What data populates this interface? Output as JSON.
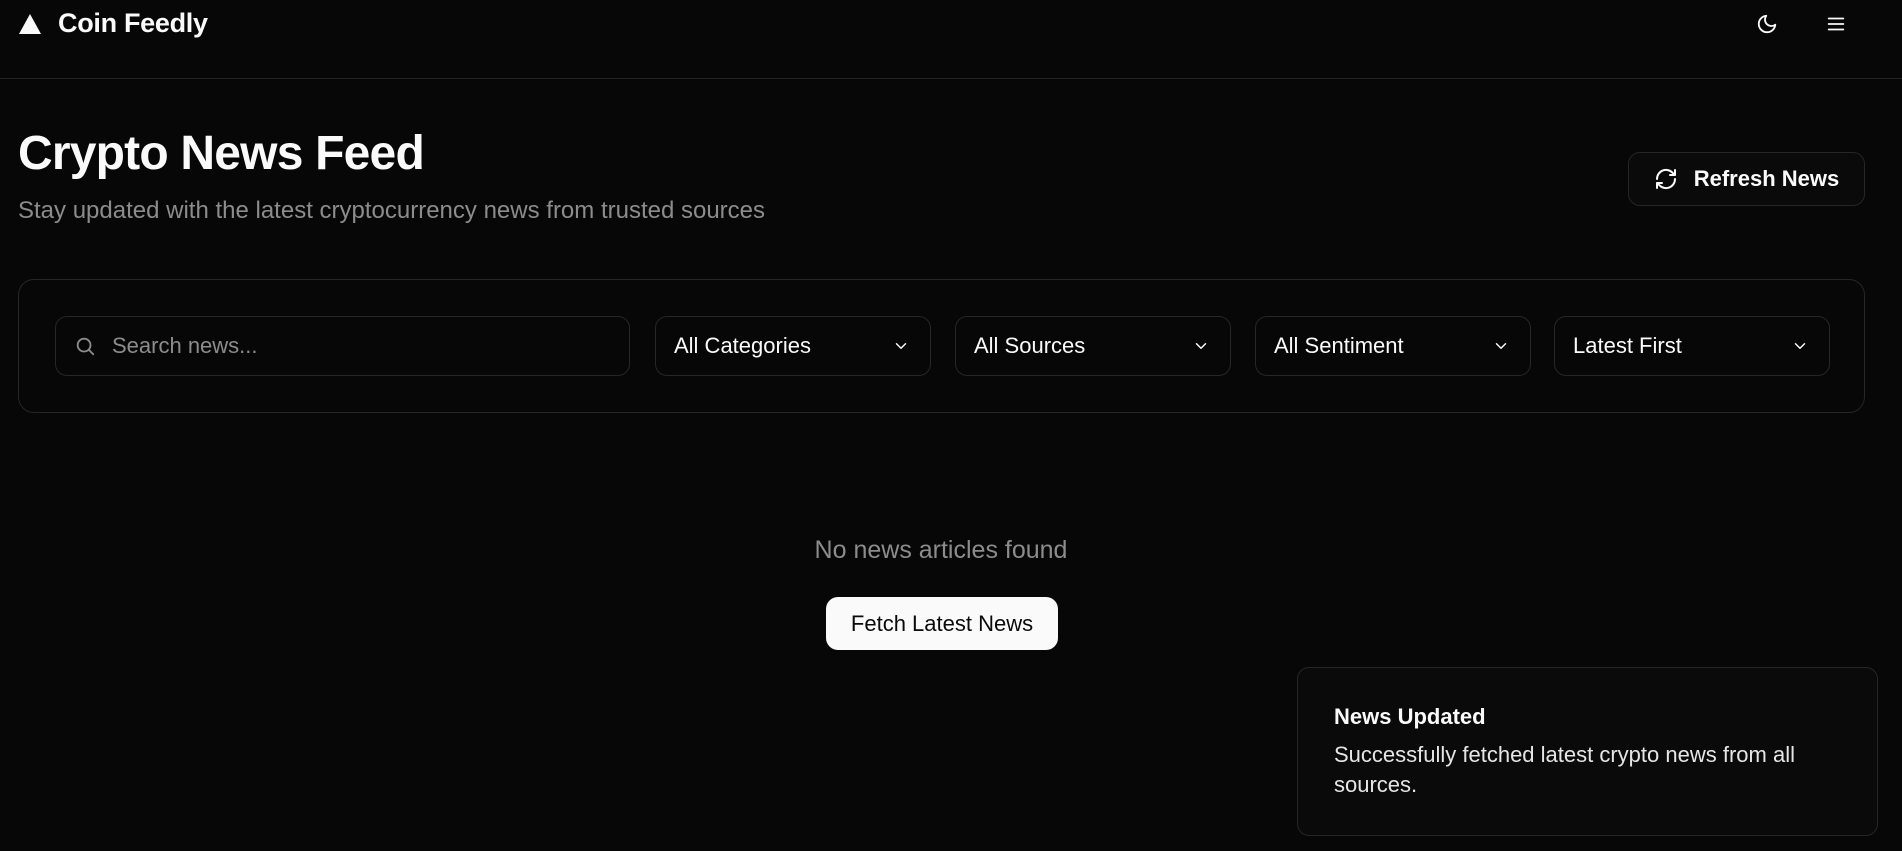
{
  "app": {
    "name": "Coin Feedly"
  },
  "header": {
    "icons": {
      "logo": "triangle-logo",
      "theme": "moon-icon",
      "menu": "hamburger-menu-icon"
    }
  },
  "main": {
    "title": "Crypto News Feed",
    "subtitle": "Stay updated with the latest cryptocurrency news from trusted sources",
    "refresh_label": "Refresh News"
  },
  "filters": {
    "search_placeholder": "Search news...",
    "search_value": "",
    "category": "All Categories",
    "source": "All Sources",
    "sentiment": "All Sentiment",
    "sort": "Latest First"
  },
  "empty_state": {
    "message": "No news articles found",
    "button_label": "Fetch Latest News"
  },
  "toast": {
    "title": "News Updated",
    "description": "Successfully fetched latest crypto news from all sources."
  },
  "colors": {
    "background": "#070707",
    "border": "#262626",
    "muted_text": "#8c8c8c",
    "primary_button": "#fafafa"
  }
}
